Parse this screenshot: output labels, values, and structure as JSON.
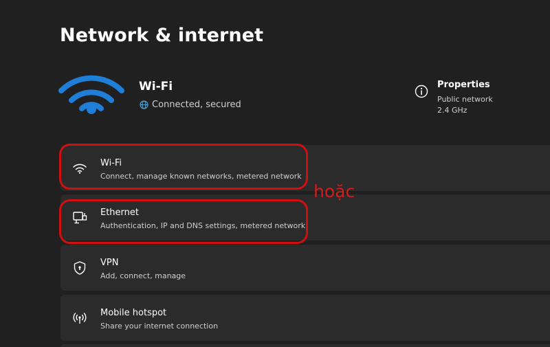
{
  "page": {
    "title": "Network & internet"
  },
  "hero": {
    "title": "Wi-Fi",
    "status": "Connected, secured",
    "icon": "wifi-icon",
    "accent_color": "#1f7ed8"
  },
  "properties": {
    "title": "Properties",
    "network_type": "Public network",
    "band": "2.4 GHz",
    "icon": "info-icon"
  },
  "cards": [
    {
      "icon": "wifi-icon",
      "title": "Wi-Fi",
      "subtitle": "Connect, manage known networks, metered network"
    },
    {
      "icon": "ethernet-icon",
      "title": "Ethernet",
      "subtitle": "Authentication, IP and DNS settings, metered network"
    },
    {
      "icon": "shield-icon",
      "title": "VPN",
      "subtitle": "Add, connect, manage"
    },
    {
      "icon": "hotspot-icon",
      "title": "Mobile hotspot",
      "subtitle": "Share your internet connection"
    }
  ],
  "annotation": {
    "text": "hoặc",
    "color": "#d31d1d"
  }
}
